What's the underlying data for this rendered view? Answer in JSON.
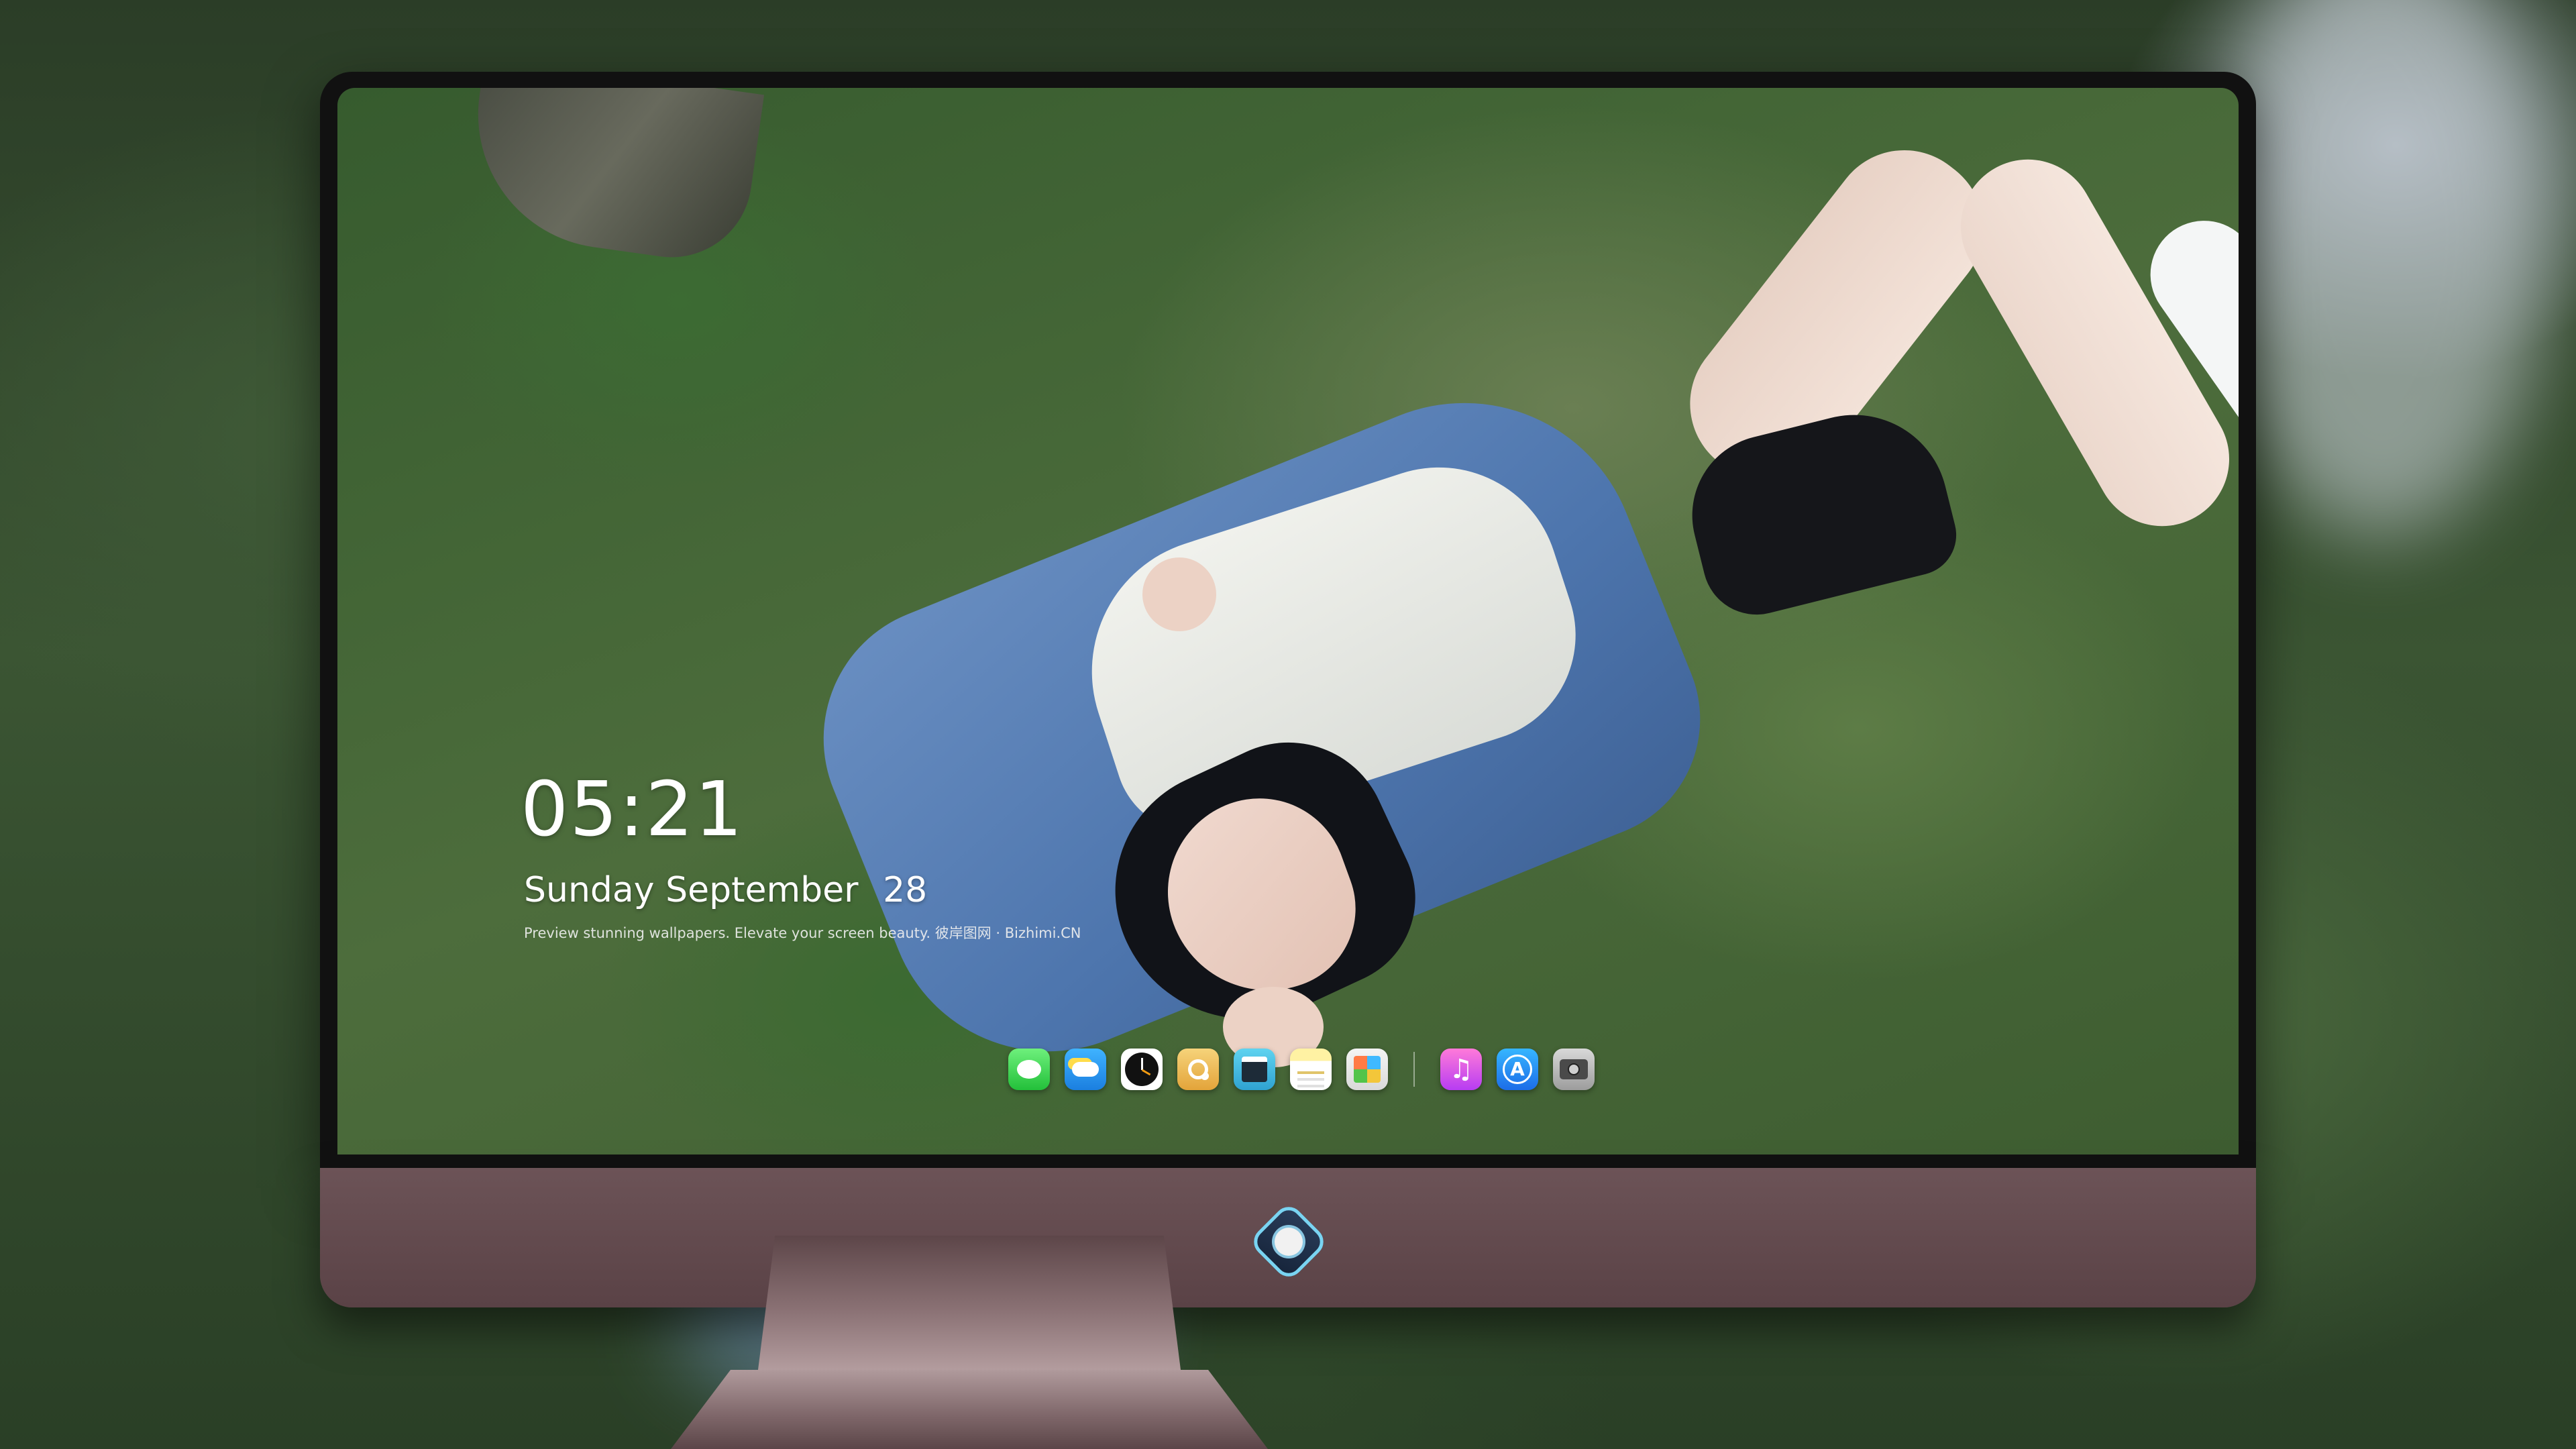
{
  "lock_screen": {
    "time": "05:21",
    "weekday": "Sunday",
    "month": "September",
    "day": "28",
    "tagline": "Preview stunning wallpapers. Elevate your screen beauty. 彼岸图网 · Bizhimi.CN"
  },
  "dock": {
    "apps": [
      {
        "name": "messages-icon",
        "color": "#2fcf44"
      },
      {
        "name": "weather-icon",
        "color": "#1b7fe0"
      },
      {
        "name": "clock-icon",
        "color": "#ffffff"
      },
      {
        "name": "preview-icon",
        "color": "#e3a43a"
      },
      {
        "name": "clips-icon",
        "color": "#2fa2d1"
      },
      {
        "name": "notes-icon",
        "color": "#fff2a3"
      },
      {
        "name": "photos-icon",
        "color": "#e0e0e0"
      },
      {
        "name": "music-icon",
        "color": "#d94df0"
      },
      {
        "name": "app-store-icon",
        "color": "#1c6de8"
      },
      {
        "name": "camera-icon",
        "color": "#9d9d9d"
      }
    ],
    "music_glyph": "♫",
    "app_store_glyph": "A"
  },
  "device": {
    "chin_color": "#5a4246",
    "logo": "brand-logo-icon"
  }
}
